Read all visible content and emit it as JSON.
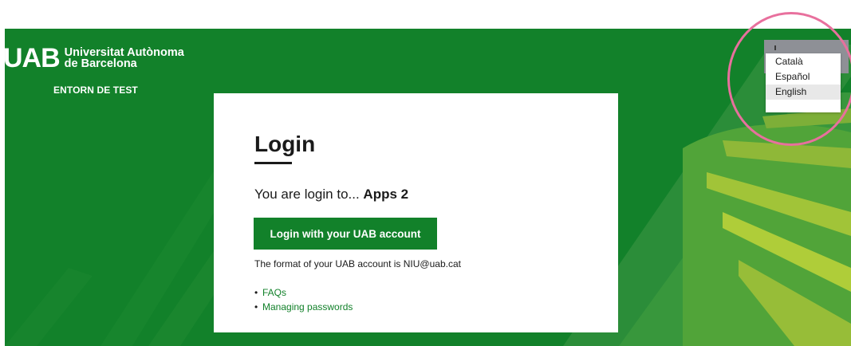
{
  "header": {
    "logo_mark": "UAB",
    "logo_line1": "Universitat Autònoma",
    "logo_line2": "de Barcelona",
    "environment_label": "ENTORN DE TEST"
  },
  "login": {
    "title": "Login",
    "subtitle_prefix": "You are login to... ",
    "app_name": "Apps 2",
    "button_label": "Login with your UAB account",
    "format_note": "The format of your UAB account is NIU@uab.cat",
    "links": [
      {
        "label": "FAQs"
      },
      {
        "label": "Managing passwords"
      }
    ]
  },
  "language_menu": {
    "options": [
      {
        "label": "Català"
      },
      {
        "label": "Español"
      },
      {
        "label": "English"
      }
    ],
    "hovered": "English"
  },
  "colors": {
    "brand_green": "#12812a",
    "annotation_ring": "#e8709d"
  }
}
